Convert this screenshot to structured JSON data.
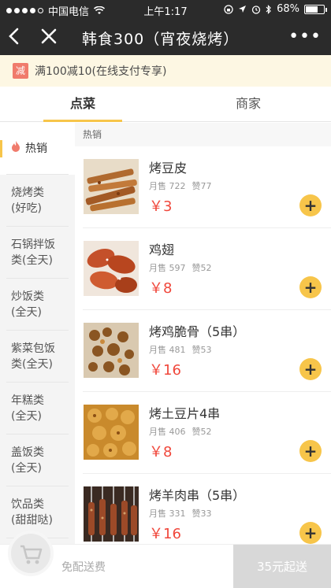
{
  "statusbar": {
    "carrier": "中国电信",
    "time": "上午1:17",
    "battery": "68%",
    "battery_level": 0.68
  },
  "navbar": {
    "title": "韩食300（宵夜烧烤）",
    "more": "•••"
  },
  "promo": {
    "tag": "减",
    "text": "满100减10(在线支付专享)"
  },
  "tabs": [
    {
      "label": "点菜"
    },
    {
      "label": "商家"
    }
  ],
  "sidebar": {
    "items": [
      {
        "label": "热销"
      },
      {
        "label": "烧烤类\n(好吃)"
      },
      {
        "label": "石锅拌饭\n类(全天)"
      },
      {
        "label": "炒饭类\n(全天)"
      },
      {
        "label": "紫菜包饭\n类(全天)"
      },
      {
        "label": "年糕类\n(全天)"
      },
      {
        "label": "盖饭类\n(全天)"
      },
      {
        "label": "饮品类\n(甜甜哒)"
      }
    ]
  },
  "list": {
    "section": "热销",
    "items": [
      {
        "name": "烤豆皮",
        "sales": "月售 722",
        "likes": "赞77",
        "price": "￥3"
      },
      {
        "name": "鸡翅",
        "sales": "月售 597",
        "likes": "赞52",
        "price": "￥8"
      },
      {
        "name": "烤鸡脆骨（5串）",
        "sales": "月售 481",
        "likes": "赞53",
        "price": "￥16"
      },
      {
        "name": "烤土豆片4串",
        "sales": "月售 406",
        "likes": "赞52",
        "price": "￥8"
      },
      {
        "name": "烤羊肉串（5串）",
        "sales": "月售 331",
        "likes": "赞33",
        "price": "￥16"
      }
    ]
  },
  "bottombar": {
    "free_delivery": "免配送费",
    "checkout": "35元起送"
  }
}
